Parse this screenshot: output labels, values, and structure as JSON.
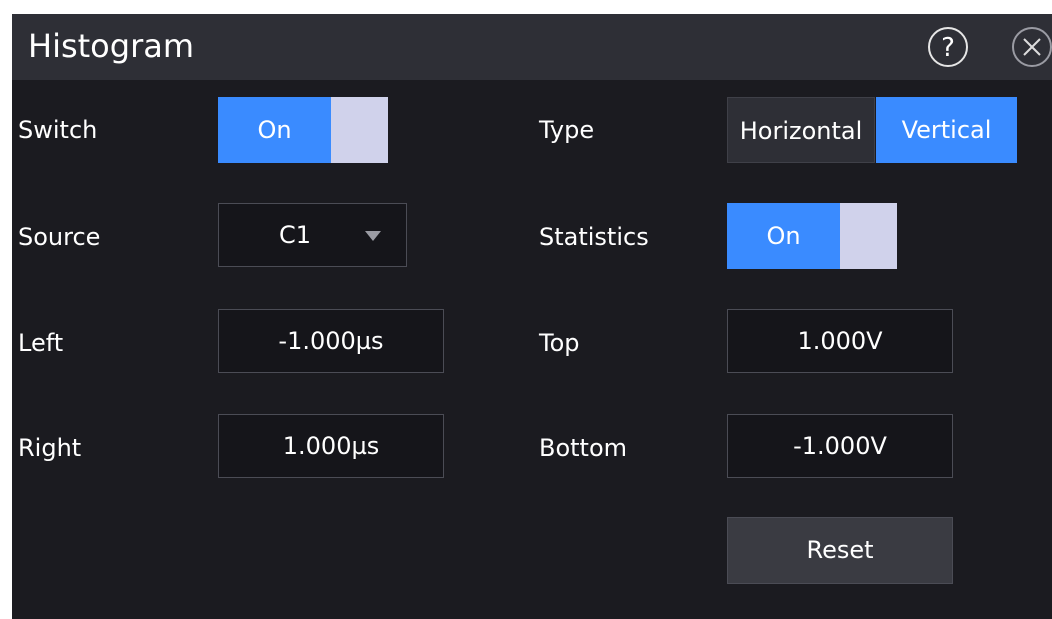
{
  "window": {
    "title": "Histogram",
    "help_icon": "help-icon",
    "close_icon": "close-icon"
  },
  "left_column": {
    "switch_label": "Switch",
    "switch_value": "On",
    "source_label": "Source",
    "source_value": "C1",
    "left_label": "Left",
    "left_value": "-1.000µs",
    "right_label": "Right",
    "right_value": "1.000µs"
  },
  "right_column": {
    "type_label": "Type",
    "type_options": [
      "Horizontal",
      "Vertical"
    ],
    "type_selected": "Vertical",
    "statistics_label": "Statistics",
    "statistics_value": "On",
    "top_label": "Top",
    "top_value": "1.000V",
    "bottom_label": "Bottom",
    "bottom_value": "-1.000V",
    "reset_label": "Reset"
  },
  "colors": {
    "accent": "#3a8bff",
    "panel_bg": "#1b1b20",
    "titlebar_bg": "#2e2f36",
    "toggle_knob": "#d0d2eb"
  }
}
